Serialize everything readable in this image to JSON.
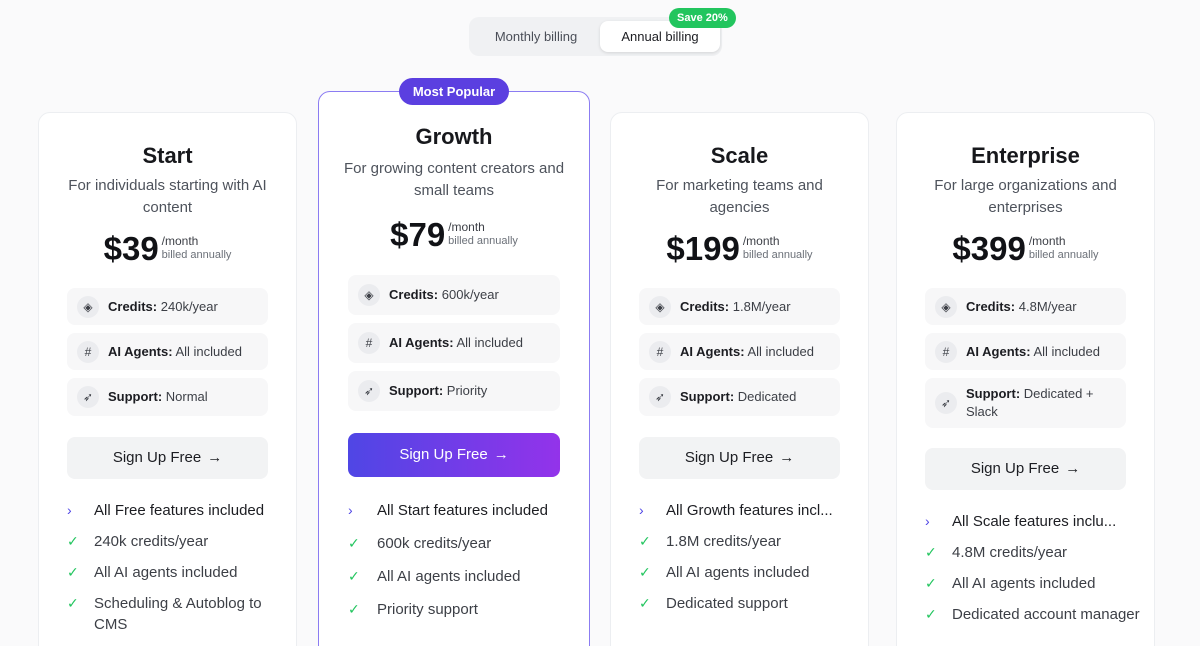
{
  "billing": {
    "monthly_label": "Monthly billing",
    "annual_label": "Annual billing",
    "save_badge": "Save 20%"
  },
  "popular_badge": "Most Popular",
  "plans": [
    {
      "name": "Start",
      "description": "For individuals starting with AI content",
      "price": "$39",
      "per": "/month",
      "billed": "billed annually",
      "credits_label": "Credits:",
      "credits_value": "240k/year",
      "agents_label": "AI Agents:",
      "agents_value": "All included",
      "support_label": "Support:",
      "support_value": "Normal",
      "cta": "Sign Up Free",
      "features": [
        "All Free features included",
        "240k credits/year",
        "All AI agents included",
        "Scheduling & Autoblog to CMS"
      ]
    },
    {
      "name": "Growth",
      "description": "For growing content creators and small teams",
      "price": "$79",
      "per": "/month",
      "billed": "billed annually",
      "credits_label": "Credits:",
      "credits_value": "600k/year",
      "agents_label": "AI Agents:",
      "agents_value": "All included",
      "support_label": "Support:",
      "support_value": "Priority",
      "cta": "Sign Up Free",
      "features": [
        "All Start features included",
        "600k credits/year",
        "All AI agents included",
        "Priority support"
      ]
    },
    {
      "name": "Scale",
      "description": "For marketing teams and agencies",
      "price": "$199",
      "per": "/month",
      "billed": "billed annually",
      "credits_label": "Credits:",
      "credits_value": "1.8M/year",
      "agents_label": "AI Agents:",
      "agents_value": "All included",
      "support_label": "Support:",
      "support_value": "Dedicated",
      "cta": "Sign Up Free",
      "features": [
        "All Growth features incl...",
        "1.8M credits/year",
        "All AI agents included",
        "Dedicated support"
      ]
    },
    {
      "name": "Enterprise",
      "description": "For large organizations and enterprises",
      "price": "$399",
      "per": "/month",
      "billed": "billed annually",
      "credits_label": "Credits:",
      "credits_value": "4.8M/year",
      "agents_label": "AI Agents:",
      "agents_value": "All included",
      "support_label": "Support:",
      "support_value": "Dedicated + Slack",
      "cta": "Sign Up Free",
      "features": [
        "All Scale features inclu...",
        "4.8M credits/year",
        "All AI agents included",
        "Dedicated account manager"
      ]
    }
  ],
  "icons": {
    "credits": "coin-icon",
    "agents": "hash-icon",
    "support": "rocket-icon",
    "arrow": "arrow-right-icon",
    "chevron": "chevron-right-icon",
    "check": "check-icon"
  },
  "colors": {
    "accent": "#4f46e5",
    "accent_end": "#9333ea",
    "success": "#22c55e",
    "popular_badge": "#5b3fe0"
  }
}
